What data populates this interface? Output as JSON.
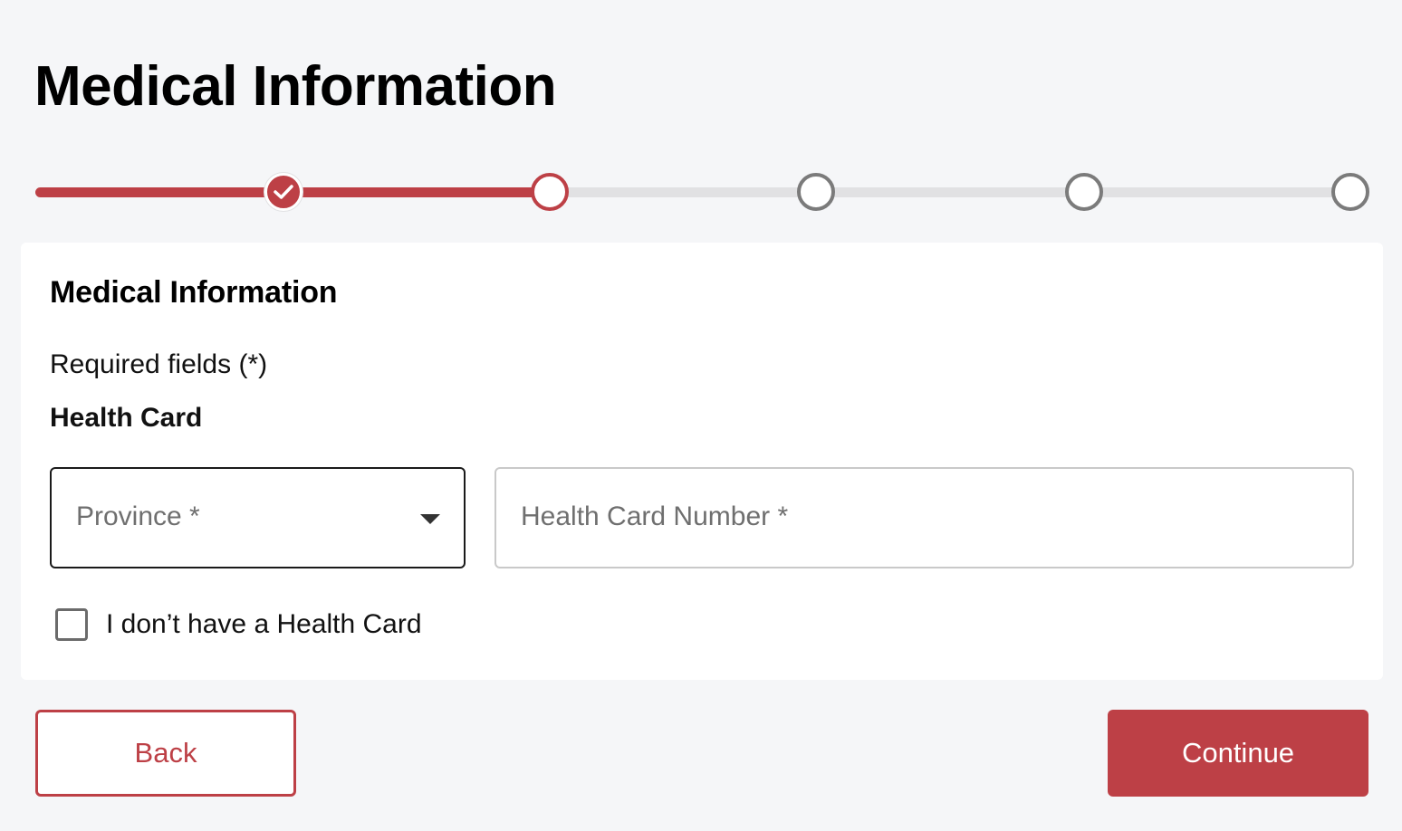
{
  "page": {
    "title": "Medical Information"
  },
  "stepper": {
    "steps": [
      {
        "status": "complete",
        "icon": "checkmark-icon"
      },
      {
        "status": "current"
      },
      {
        "status": "pending"
      },
      {
        "status": "pending"
      },
      {
        "status": "pending"
      }
    ],
    "colors": {
      "accent": "#bd4046",
      "pending_track": "#e1e1e3",
      "pending_border": "#7b7b7b"
    }
  },
  "card": {
    "title": "Medical Information",
    "required_note": "Required fields (*)",
    "section_label": "Health Card",
    "province": {
      "placeholder": "Province *",
      "value": ""
    },
    "health_card_number": {
      "placeholder": "Health Card Number *",
      "value": ""
    },
    "no_card_checkbox": {
      "label": "I don’t have a Health Card",
      "checked": false
    }
  },
  "actions": {
    "back_label": "Back",
    "continue_label": "Continue"
  }
}
